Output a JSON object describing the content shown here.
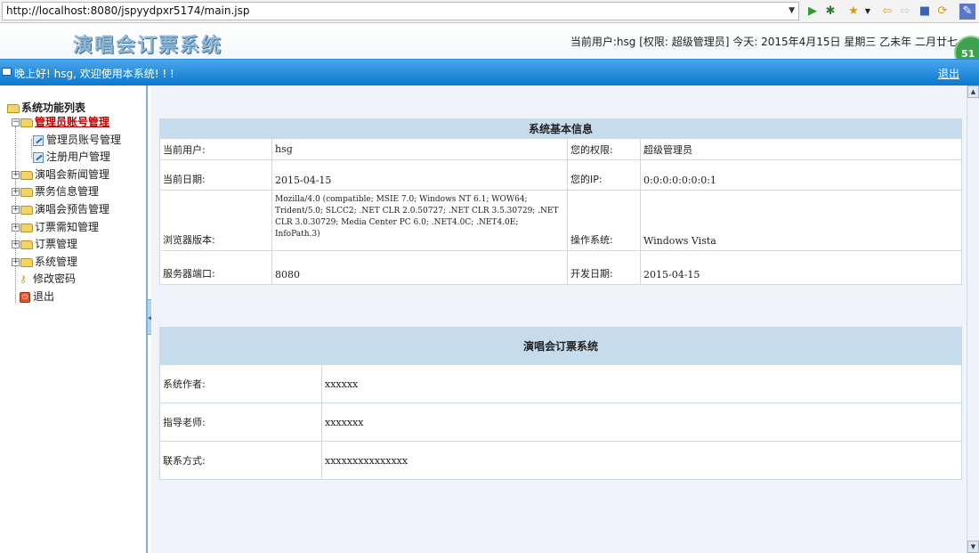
{
  "browser": {
    "url": "http://localhost:8080/jspyydpxr5174/main.jsp"
  },
  "header": {
    "title": "演唱会订票系统",
    "info": "当前用户:hsg [权限: 超级管理员] 今天: 2015年4月15日 星期三 乙未年 二月廿七",
    "badge": "51"
  },
  "bar": {
    "welcome": "晚上好! hsg, 欢迎使用本系统! ! !",
    "logout": "退出"
  },
  "sidebar": {
    "heading": "系统功能列表",
    "items": [
      {
        "label": "管理员账号管理"
      },
      {
        "label": "管理员账号管理"
      },
      {
        "label": "注册用户管理"
      },
      {
        "label": "演唱会新闻管理"
      },
      {
        "label": "票务信息管理"
      },
      {
        "label": "演唱会预告管理"
      },
      {
        "label": "订票需知管理"
      },
      {
        "label": "订票管理"
      },
      {
        "label": "系统管理"
      },
      {
        "label": "修改密码"
      },
      {
        "label": "退出"
      }
    ]
  },
  "sysinfo": {
    "heading": "系统基本信息",
    "rows": [
      {
        "l1": "当前用户:",
        "v1": "hsg",
        "l2": "您的权限:",
        "v2": "超级管理员"
      },
      {
        "l1": "当前日期:",
        "v1": "2015-04-15",
        "l2": "您的IP:",
        "v2": "0:0:0:0:0:0:0:1"
      },
      {
        "l1": "浏览器版本:",
        "v1": "Mozilla/4.0 (compatible; MSIE 7.0; Windows NT 6.1; WOW64; Trident/5.0; SLCC2; .NET CLR 2.0.50727; .NET CLR 3.5.30729; .NET CLR 3.0.30729; Media Center PC 6.0; .NET4.0C; .NET4.0E; InfoPath.3)",
        "l2": "操作系统:",
        "v2": "Windows Vista"
      },
      {
        "l1": "服务器端口:",
        "v1": "8080",
        "l2": "开发日期:",
        "v2": "2015-04-15"
      }
    ]
  },
  "about": {
    "heading": "演唱会订票系统",
    "rows": [
      {
        "label": "系统作者:",
        "value": "xxxxxx"
      },
      {
        "label": "指导老师:",
        "value": "xxxxxxx"
      },
      {
        "label": "联系方式:",
        "value": "xxxxxxxxxxxxxxx"
      }
    ]
  }
}
